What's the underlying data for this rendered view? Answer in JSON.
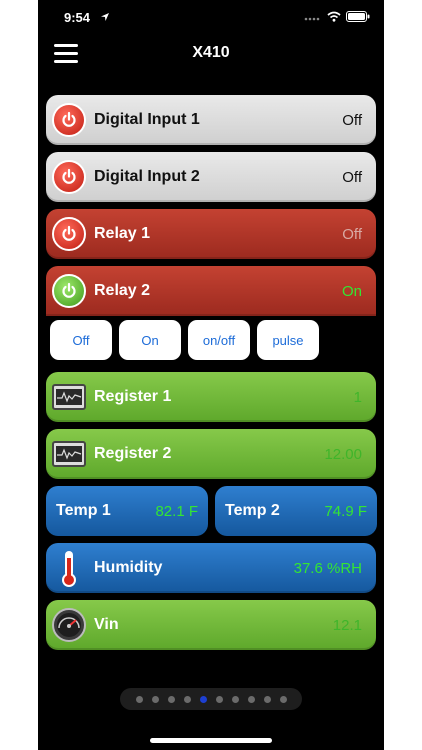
{
  "status_bar": {
    "time": "9:54"
  },
  "nav": {
    "title": "X410"
  },
  "tiles": [
    {
      "label": "Digital Input 1",
      "value": "Off"
    },
    {
      "label": "Digital Input 2",
      "value": "Off"
    },
    {
      "label": "Relay 1",
      "value": "Off"
    },
    {
      "label": "Relay 2",
      "value": "On"
    }
  ],
  "relay_buttons": [
    "Off",
    "On",
    "on/off",
    "pulse"
  ],
  "registers": [
    {
      "label": "Register 1",
      "value": "1"
    },
    {
      "label": "Register 2",
      "value": "12.00"
    }
  ],
  "temps": [
    {
      "label": "Temp 1",
      "value": "82.1 F"
    },
    {
      "label": "Temp 2",
      "value": "74.9 F"
    }
  ],
  "humidity": {
    "label": "Humidity",
    "value": "37.6 %RH"
  },
  "vin": {
    "label": "Vin",
    "value": "12.1"
  },
  "pager": {
    "pages": 10,
    "active_index": 4
  },
  "colors": {
    "value_green": "#33e633",
    "value_dark_green": "#3fb52a",
    "button_blue": "#1d6cd8",
    "page_active": "#1d3fd1"
  }
}
